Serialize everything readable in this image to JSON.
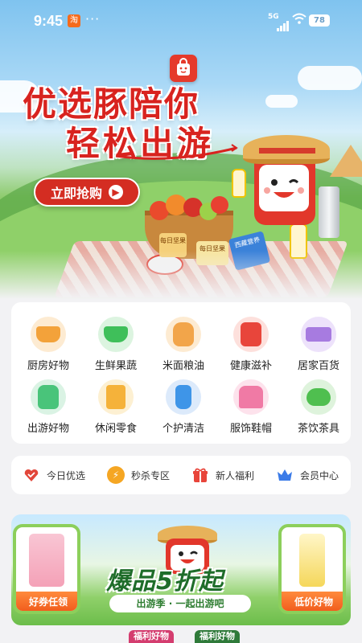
{
  "status_bar": {
    "time": "9:45",
    "app_badge": "淘",
    "more": "···",
    "network": "5G",
    "battery": "78"
  },
  "hero": {
    "headline_line1": "优选豚陪你",
    "headline_line2": "轻松出游",
    "cta_label": "立即抢购",
    "snack_label_1": "每日坚果",
    "snack_label_2": "西藏营养",
    "snack_label_3": "每日坚果"
  },
  "categories": [
    {
      "label": "厨房好物",
      "icon": "pot-icon",
      "color": "#f3a23a"
    },
    {
      "label": "生鲜果蔬",
      "icon": "vegetable-basket-icon",
      "color": "#3fbf5a"
    },
    {
      "label": "米面粮油",
      "icon": "rice-sack-icon",
      "color": "#f2a54a"
    },
    {
      "label": "健康滋补",
      "icon": "supplement-jar-icon",
      "color": "#e8453b"
    },
    {
      "label": "居家百货",
      "icon": "home-goods-icon",
      "color": "#a77be0"
    },
    {
      "label": "出游好物",
      "icon": "backpack-icon",
      "color": "#49c47a"
    },
    {
      "label": "休闲零食",
      "icon": "snack-bag-icon",
      "color": "#f5b23a"
    },
    {
      "label": "个护清洁",
      "icon": "pump-bottle-icon",
      "color": "#3e95e8"
    },
    {
      "label": "服饰鞋帽",
      "icon": "tshirt-icon",
      "color": "#f07aa5"
    },
    {
      "label": "茶饮茶具",
      "icon": "teapot-icon",
      "color": "#4fbf4f"
    }
  ],
  "quick_links": [
    {
      "label": "今日优选",
      "icon": "heart-badge-icon",
      "color": "#e2463a"
    },
    {
      "label": "秒杀专区",
      "icon": "lightning-icon",
      "color": "#f5a623"
    },
    {
      "label": "新人福利",
      "icon": "gift-icon",
      "color": "#e8453b"
    },
    {
      "label": "会员中心",
      "icon": "crown-icon",
      "color": "#3b7be8"
    }
  ],
  "promo": {
    "left_tag": "好券任领",
    "right_tag": "低价好物",
    "headline": "爆品5折起",
    "sub": "出游季 · 一起出游吧"
  },
  "bottom_tabs": [
    {
      "label": "福利好物"
    },
    {
      "label": "福利好物"
    }
  ]
}
